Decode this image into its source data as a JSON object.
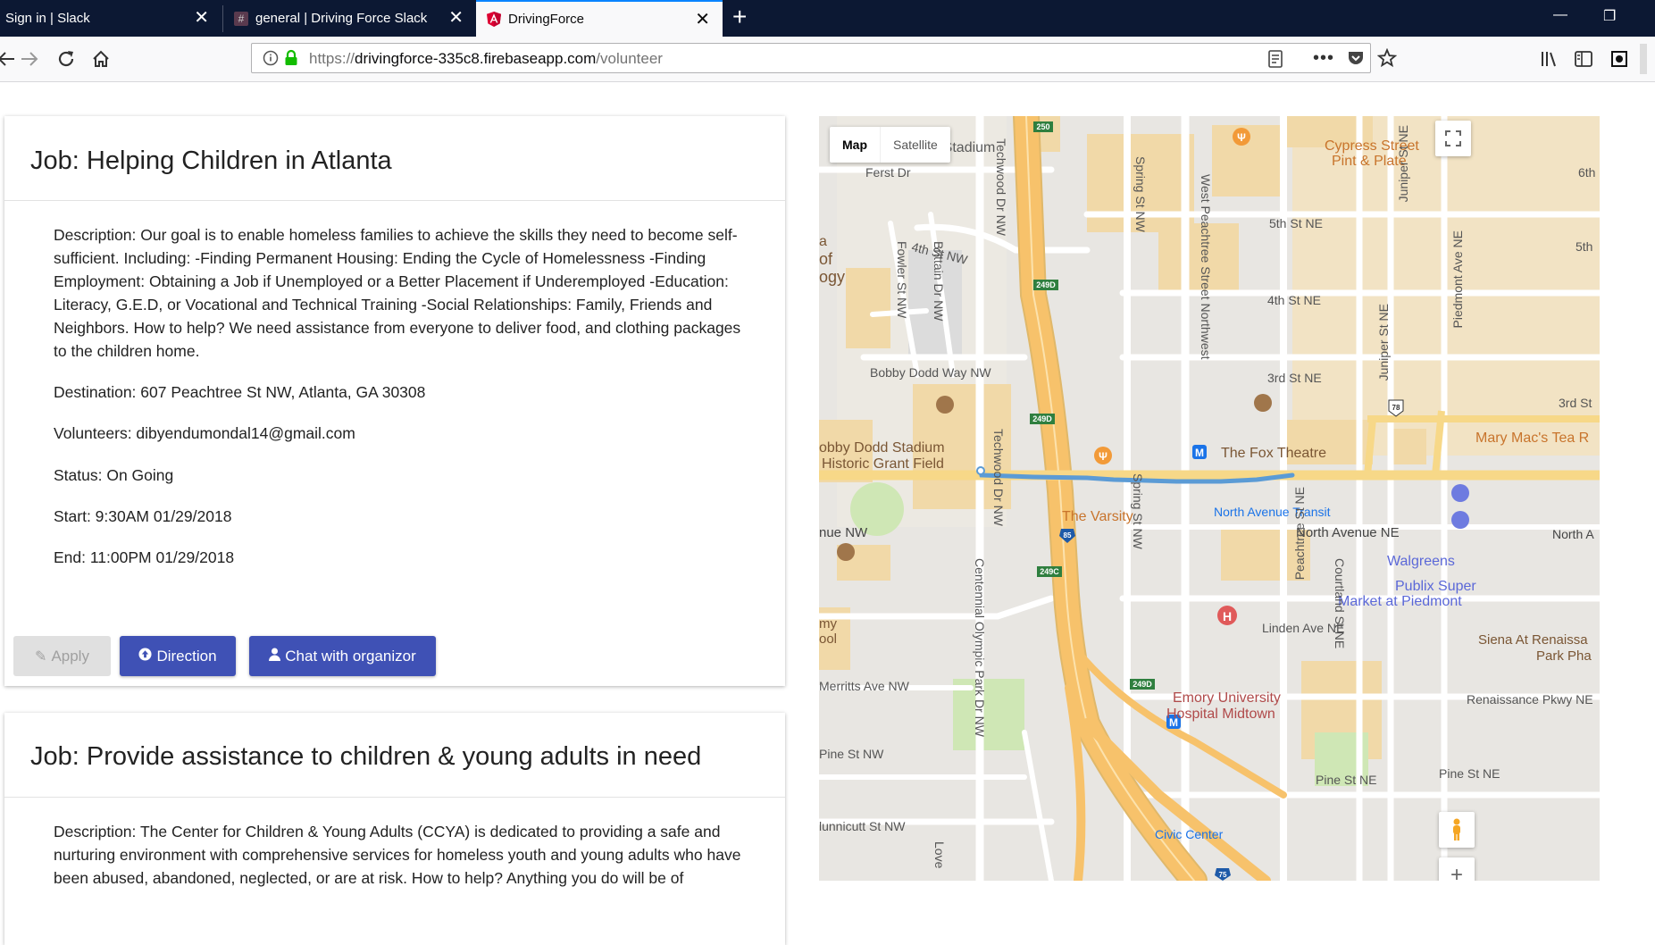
{
  "browser": {
    "tabs": [
      {
        "label": "Sign in | Slack",
        "favicon": "slack-icon"
      },
      {
        "label": "general | Driving Force Slack",
        "favicon": "hash-icon"
      },
      {
        "label": "DrivingForce",
        "favicon": "angular-icon"
      }
    ],
    "url_prefix": "https://",
    "url_host": "drivingforce-335c8.firebaseapp.com",
    "url_path": "/volunteer"
  },
  "jobs": [
    {
      "title": "Job: Helping Children in Atlanta",
      "description": "Description: Our goal is to enable homeless families to achieve the skills they need to become self-sufficient. Including: -Finding Permanent Housing: Ending the Cycle of Homelessness -Finding Employment: Obtaining a Job if Unemployed or a Better Placement if Underemployed -Education: Literacy, G.E.D, or Vocational and Technical Training -Social Relationships: Family, Friends and Neighbors. How to help? We need assistance from everyone to deliver food, and clothing packages to the children home.",
      "destination": "Destination: 607 Peachtree St NW, Atlanta, GA 30308",
      "volunteers": "Volunteers: dibyendumondal14@gmail.com",
      "status": "Status: On Going",
      "start": "Start: 9:30AM 01/29/2018",
      "end": "End: 11:00PM 01/29/2018",
      "buttons": {
        "apply": "Apply",
        "direction": "Direction",
        "chat": "Chat with organizor"
      }
    },
    {
      "title": "Job: Provide assistance to children & young adults in need",
      "description": "Description: The Center for Children & Young Adults (CCYA) is dedicated to providing a safe and nurturing environment with comprehensive services for homeless youth and young adults who have been abused, abandoned, neglected, or are at risk. How to help? Anything you do will be of"
    }
  ],
  "map": {
    "type_map": "Map",
    "type_satellite": "Satellite",
    "labels": {
      "stadium_top": "er Stadium",
      "ferst": "Ferst Dr",
      "cypress1": "Cypress Street",
      "cypress2": "Pint & Plate",
      "sixth": "6th",
      "fifth_ne": "5th St NE",
      "fifth2": "5th",
      "fourth_nw": "4th St NW",
      "fourth_ne": "4th St NE",
      "third_ne": "3rd St NE",
      "third2": "3rd St",
      "bobby_way": "Bobby Dodd Way NW",
      "bobby1": "obby Dodd Stadium",
      "bobby2": "Historic Grant Field",
      "fox": "The Fox Theatre",
      "marys": "Mary Mac's Tea R",
      "varsity": "The Varsity",
      "transit": "North Avenue Transit",
      "ave_nw": "nue NW",
      "north_ne": "North Avenue NE",
      "north_a": "North A",
      "walgreens": "Walgreens",
      "publix1": "Publix Super",
      "publix2": "Market at Piedmont",
      "linden": "Linden Ave NE",
      "siena1": "Siena At Renaissa",
      "siena2": "Park Pha",
      "merritts": "Merritts Ave NW",
      "renaissance": "Renaissance Pkwy NE",
      "emory1": "Emory University",
      "emory2": "Hospital Midtown",
      "pine_nw": "Pine St NW",
      "pine_ne": "Pine St NE",
      "pine_ne2": "Pine St NE",
      "hunnicutt": "lunnicutt St NW",
      "civic": "Civic Center",
      "of1": "a",
      "of2": "of",
      "of3": "ogy",
      "my1": "my",
      "my2": "ool",
      "lovej": "Love",
      "techwood": "Techwood Dr NW",
      "techwood2": "Techwood Dr NW",
      "spring_nw": "Spring St NW",
      "spring_nw2": "Spring St NW",
      "west_peach": "West Peachtree Street Northwest",
      "juniper1": "Juniper St NE",
      "juniper2": "Juniper St NE",
      "piedmont": "Piedmont Ave NE",
      "fowler": "Fowler St NW",
      "brittain": "Brittain Dr NW",
      "peachtree_ne": "Peachtree St NE",
      "courtland": "Courtland St NE",
      "centennial": "Centennial Olympic Park Dr NW",
      "shield_250": "250",
      "shield_249d_1": "249D",
      "shield_249d_2": "249D",
      "shield_249c": "249C",
      "shield_249d_3": "249D",
      "shield_85": "85",
      "shield_75": "75",
      "shield_78": "78"
    },
    "colors": {
      "route": "#5b9bd5",
      "highway": "#f7c26b",
      "campus": "#f4dfb1",
      "poi_orange": "#f29a38",
      "transit_blue": "#1a73e8"
    }
  }
}
